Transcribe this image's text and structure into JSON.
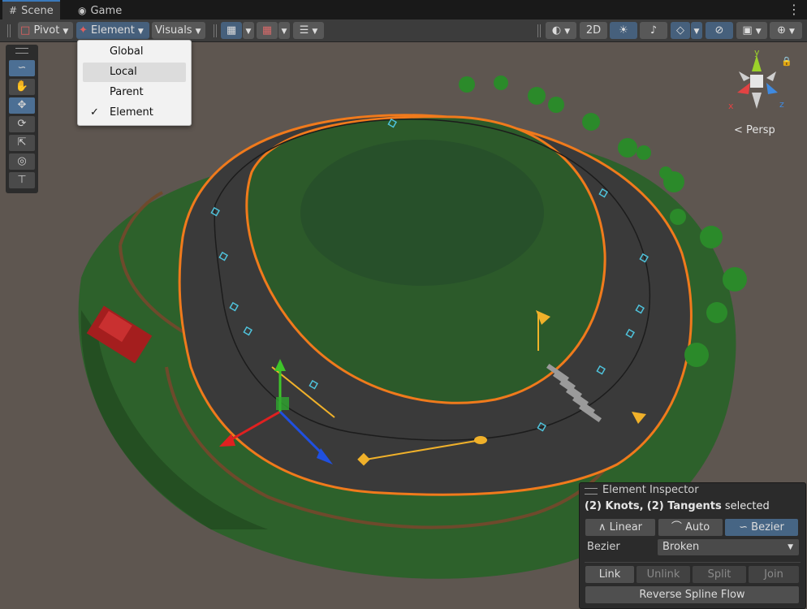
{
  "tabs": [
    {
      "icon": "grid-icon",
      "label": "Scene"
    },
    {
      "icon": "gamepad-icon",
      "label": "Game"
    }
  ],
  "toolbar": {
    "pivot_label": "Pivot",
    "element_label": "Element",
    "visuals_label": "Visuals",
    "mode_2d_label": "2D"
  },
  "orientation_menu": {
    "items": [
      "Global",
      "Local",
      "Parent",
      "Element"
    ],
    "checked": "Element",
    "highlighted": "Local"
  },
  "tools": [
    "spline-tool-icon",
    "hand-icon",
    "move-icon",
    "rotate-icon",
    "scale-icon",
    "transform-icon",
    "custom-tool-icon"
  ],
  "scene_gizmo": {
    "y_label": "y",
    "x_label": "x",
    "z_label": "z",
    "projection_label": "Persp"
  },
  "inspector": {
    "title": "Element Inspector",
    "sel_knots_count": "(2) Knots,",
    "sel_tangents_count": "(2) Tangents",
    "sel_suffix": "selected",
    "tangent_modes": [
      "Linear",
      "Auto",
      "Bezier"
    ],
    "active_mode": "Bezier",
    "bezier_label": "Bezier",
    "bezier_value": "Broken",
    "actions": [
      "Link",
      "Unlink",
      "Split",
      "Join"
    ],
    "reverse_label": "Reverse Spline Flow"
  },
  "colors": {
    "accent": "#3a79bb",
    "selection_outline": "#f07a1c",
    "grass": "#2e6b2e",
    "road": "#3a3a3a",
    "spline": "#4fc3dc"
  }
}
